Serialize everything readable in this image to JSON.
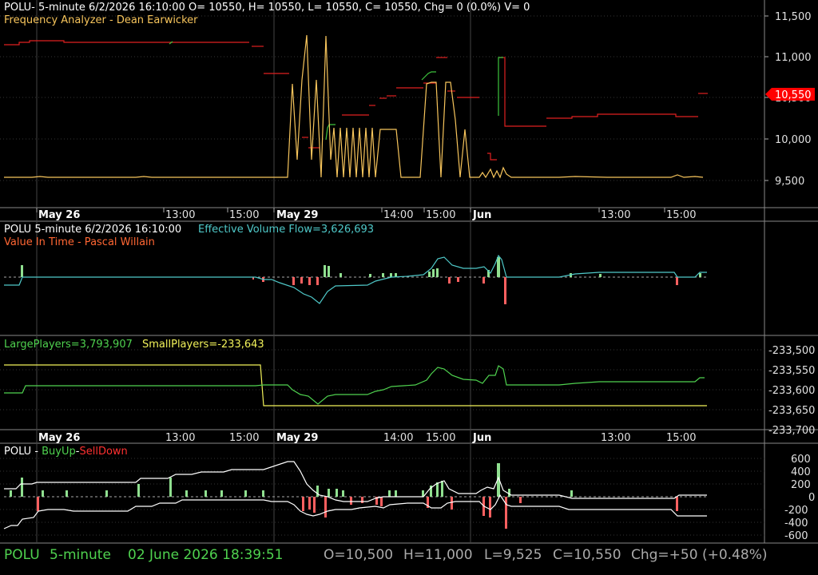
{
  "colors": {
    "orange": "#f7c55c",
    "red": "#ff3030",
    "green": "#4fd24f",
    "teal": "#4fc9c9",
    "ltgreen": "#90e090",
    "yellow": "#f2f25a",
    "white": "#ffffff",
    "salmon": "#ff6060"
  },
  "panel1": {
    "header": "POLU- 5-minute 6/2/2026 16:10:00 O= 10550, H= 10550, L= 10550, C= 10550, Chg= 0 (0.0%) V= 0",
    "indicator": "Frequency Analyzer - Dean Earwicker",
    "y_ticks": [
      "11,500",
      "11,000",
      "10,500",
      "10,000",
      "9,500"
    ],
    "price_tag": "10,550"
  },
  "dates": [
    "May 26",
    "13:00",
    "15:00",
    "May 29",
    "14:00",
    "15:00",
    "Jun",
    "13:00",
    "15:00"
  ],
  "panel2": {
    "header_left": "POLU 5-minute  6/2/2026 16:10:00",
    "header_right": "Effective Volume Flow=3,626,693",
    "indicator": "Value In Time - Pascal Willain"
  },
  "panel3": {
    "large": "LargePlayers=3,793,907",
    "small": "SmallPlayers=-233,643",
    "y_ticks": [
      "-233,500",
      "-233,550",
      "-233,600",
      "-233,650",
      "-233,700"
    ]
  },
  "panel4": {
    "prefix": "POLU - ",
    "buy": "BuyUp",
    "dash": "-",
    "sell": "SellDown",
    "y_ticks": [
      "600",
      "400",
      "200",
      "0",
      "-200",
      "-400",
      "-600"
    ]
  },
  "status": {
    "symbol": "POLU",
    "interval": "5-minute",
    "datetime": "02 June 2026 18:39:51",
    "open": "O=10,500",
    "high": "H=11,000",
    "low": "L=9,525",
    "close": "C=10,550",
    "chg": "Chg=+50 (+0.48%)"
  },
  "chart_data": [
    {
      "type": "line",
      "title": "Frequency Analyzer - Dean Earwicker",
      "ylim": [
        9250,
        11750
      ],
      "x": [
        0,
        3,
        6,
        9,
        12,
        15,
        17,
        18,
        19,
        20,
        21,
        22,
        23,
        24,
        25,
        26,
        27,
        28,
        29,
        30,
        31,
        32,
        33,
        34,
        35,
        36,
        37,
        38,
        39,
        40,
        41,
        42,
        43,
        44,
        45,
        46,
        47,
        48,
        49,
        50
      ],
      "series": [
        {
          "name": "orange",
          "values": [
            9525,
            9525,
            9525,
            9525,
            9525,
            9525,
            9525,
            10600,
            11250,
            10800,
            10000,
            11250,
            10500,
            9600,
            10200,
            9500,
            10200,
            9500,
            10200,
            9500,
            10100,
            9500,
            10100,
            10100,
            10100,
            9500,
            9500,
            10600,
            10700,
            10700,
            10600,
            10100,
            9500,
            9525,
            9575,
            9525,
            9525,
            9525,
            9525,
            9525
          ]
        }
      ]
    },
    {
      "type": "bar",
      "title": "Value In Time - Pascal Willain",
      "series": [
        {
          "name": "Effective Volume Flow",
          "values": [
            3626693
          ]
        }
      ]
    },
    {
      "type": "line",
      "title": "LargePlayers / SmallPlayers",
      "ylim": [
        -233700,
        -233500
      ],
      "series": [
        {
          "name": "LargePlayers",
          "values": [
            -233600,
            -233580,
            -233580,
            -233580,
            -233600,
            -233640,
            -233600,
            -233580,
            -233540,
            -233570,
            -233560,
            -233580,
            -233530,
            -233580,
            -233575,
            -233575,
            -233570
          ]
        },
        {
          "name": "SmallPlayers",
          "values": [
            -233540,
            -233540,
            -233540,
            -233540,
            -233655,
            -233655,
            -233655,
            -233655,
            -233655,
            -233655,
            -233655,
            -233655,
            -233655,
            -233655,
            -233655,
            -233655,
            -233655
          ]
        }
      ]
    },
    {
      "type": "bar",
      "title": "BuyUp-SellDown",
      "ylim": [
        -600,
        600
      ],
      "series": [
        {
          "name": "BuyUp",
          "values": [
            80,
            300,
            80,
            100,
            150,
            100,
            200,
            250,
            100,
            150,
            200,
            520,
            250,
            80
          ]
        },
        {
          "name": "SellDown",
          "values": [
            -200,
            -300,
            -250,
            -200,
            -150,
            -100,
            -150,
            -200,
            -350,
            -500,
            -200
          ]
        }
      ]
    }
  ]
}
